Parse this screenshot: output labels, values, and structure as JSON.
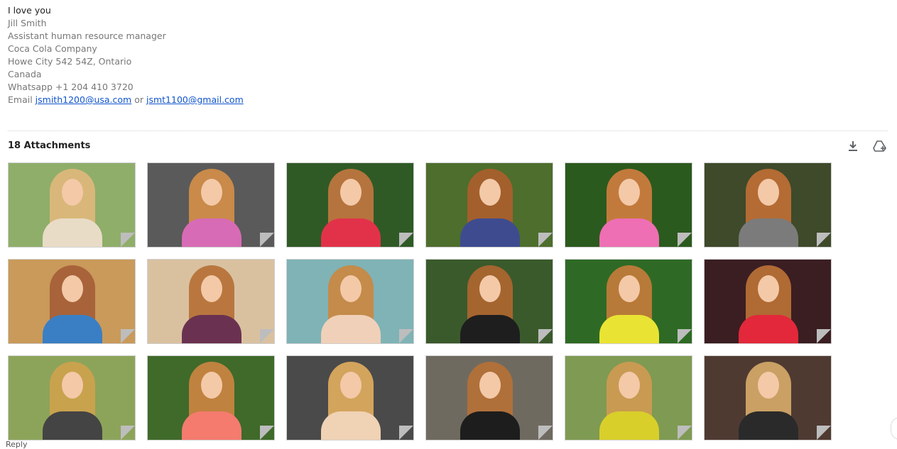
{
  "signature": {
    "greeting": "I love you",
    "lines": [
      "Jill Smith",
      "Assistant human resource manager",
      "Coca Cola Company",
      "Howe City 542 54Z, Ontario",
      "Canada",
      "Whatsapp +1 204 410 3720"
    ],
    "email_prefix": "Email",
    "email_1": "jsmith1200@usa.com",
    "email_connector": "or",
    "email_2": "jsmt1100@gmail.com"
  },
  "attachments": {
    "header": "18 Attachments",
    "actions": [
      {
        "icon": "download-icon",
        "label": "Download all"
      },
      {
        "icon": "add-to-drive-icon",
        "label": "Add all to Drive"
      }
    ],
    "items": [
      {
        "icon": "image-thumbnail",
        "palette": {
          "bg": "#8fae6a",
          "hair": "#d9b77a",
          "body": "#e8dcc6"
        }
      },
      {
        "icon": "image-thumbnail",
        "palette": {
          "bg": "#5a5a5a",
          "hair": "#c98a4a",
          "body": "#d86bb5"
        }
      },
      {
        "icon": "image-thumbnail",
        "palette": {
          "bg": "#2f5a26",
          "hair": "#b5743d",
          "body": "#e2324a"
        }
      },
      {
        "icon": "image-thumbnail",
        "palette": {
          "bg": "#4d6e2c",
          "hair": "#a3602d",
          "body": "#3e4c8f"
        }
      },
      {
        "icon": "image-thumbnail",
        "palette": {
          "bg": "#2b5a1e",
          "hair": "#c27a3c",
          "body": "#ee6fb3"
        }
      },
      {
        "icon": "image-thumbnail",
        "palette": {
          "bg": "#3e4a2a",
          "hair": "#b46b34",
          "body": "#7b7b7b"
        }
      },
      {
        "icon": "image-thumbnail",
        "palette": {
          "bg": "#c99a5a",
          "hair": "#a8633a",
          "body": "#3a7fc4"
        }
      },
      {
        "icon": "image-thumbnail",
        "palette": {
          "bg": "#d9c1a0",
          "hair": "#b9773f",
          "body": "#6a3250"
        }
      },
      {
        "icon": "image-thumbnail",
        "palette": {
          "bg": "#7fb3b6",
          "hair": "#c48b4a",
          "body": "#f0d0b8"
        }
      },
      {
        "icon": "image-thumbnail",
        "palette": {
          "bg": "#3a5a2c",
          "hair": "#a4652f",
          "body": "#1e1e1e"
        }
      },
      {
        "icon": "image-thumbnail",
        "palette": {
          "bg": "#2e6a25",
          "hair": "#b87a38",
          "body": "#e9e433"
        }
      },
      {
        "icon": "image-thumbnail",
        "palette": {
          "bg": "#3b1e22",
          "hair": "#b06a34",
          "body": "#e2283a"
        }
      },
      {
        "icon": "image-thumbnail",
        "palette": {
          "bg": "#8ca45a",
          "hair": "#c9a24e",
          "body": "#444444"
        }
      },
      {
        "icon": "image-thumbnail",
        "palette": {
          "bg": "#3f6a2a",
          "hair": "#c0823f",
          "body": "#f47b6e"
        }
      },
      {
        "icon": "image-thumbnail",
        "palette": {
          "bg": "#4a4a4a",
          "hair": "#d3a45c",
          "body": "#f0d2b5"
        }
      },
      {
        "icon": "image-thumbnail",
        "palette": {
          "bg": "#6f6a60",
          "hair": "#b0703a",
          "body": "#1d1d1d"
        }
      },
      {
        "icon": "image-thumbnail",
        "palette": {
          "bg": "#7f9a52",
          "hair": "#c99a52",
          "body": "#d8cf2a"
        }
      },
      {
        "icon": "image-thumbnail",
        "palette": {
          "bg": "#4f3a32",
          "hair": "#caa064",
          "body": "#2a2a2a"
        }
      }
    ]
  },
  "footer": {
    "snippet": "Reply"
  }
}
